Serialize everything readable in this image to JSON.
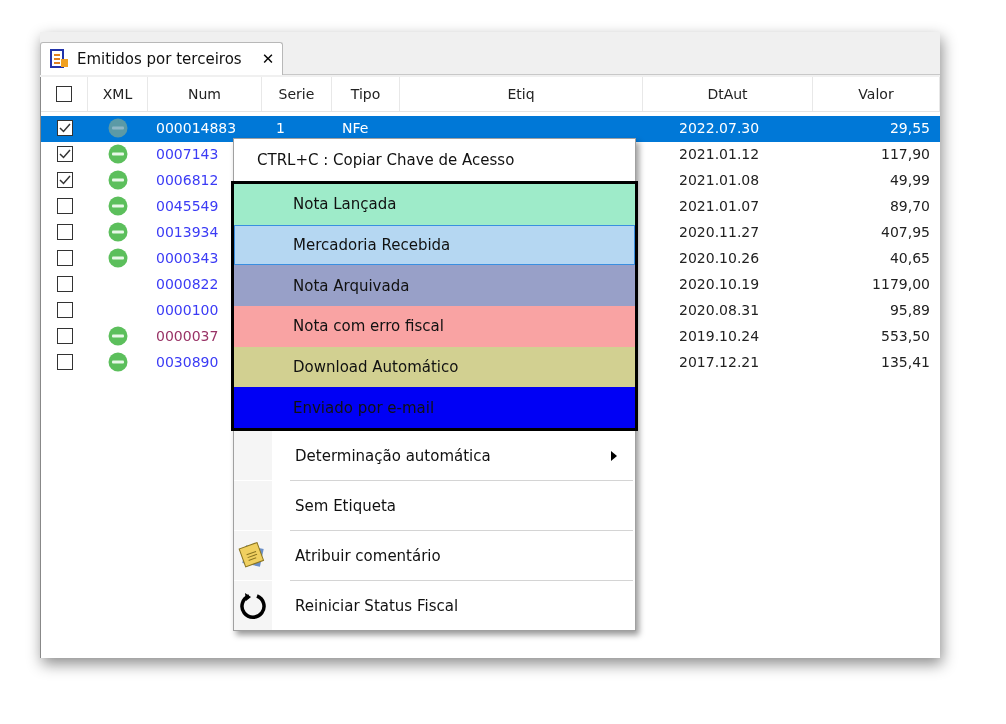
{
  "tab": {
    "title": "Emitidos por terceiros",
    "close": "✕"
  },
  "table": {
    "select_all": {
      "checked": false
    },
    "columns": [
      "XML",
      "Num",
      "Serie",
      "Tipo",
      "Etiq",
      "DtAut",
      "Valor"
    ],
    "rows": [
      {
        "selected": true,
        "checked": true,
        "xml": true,
        "num": "000014883",
        "color": "#ffffff",
        "serie": "1",
        "tipo": "NFe",
        "dtaut": "2022.07.30",
        "valor": "29,55"
      },
      {
        "selected": false,
        "checked": true,
        "xml": true,
        "num": "0007143",
        "color": "#3b3bf5",
        "dtaut": "2021.01.12",
        "valor": "117,90"
      },
      {
        "selected": false,
        "checked": true,
        "xml": true,
        "num": "0006812",
        "color": "#3b3bf5",
        "dtaut": "2021.01.08",
        "valor": "49,99"
      },
      {
        "selected": false,
        "checked": false,
        "xml": true,
        "num": "0045549",
        "color": "#3b3bf5",
        "dtaut": "2021.01.07",
        "valor": "89,70"
      },
      {
        "selected": false,
        "checked": false,
        "xml": true,
        "num": "0013934",
        "color": "#3b3bf5",
        "dtaut": "2020.11.27",
        "valor": "407,95"
      },
      {
        "selected": false,
        "checked": false,
        "xml": true,
        "num": "0000343",
        "color": "#3b3bf5",
        "dtaut": "2020.10.26",
        "valor": "40,65"
      },
      {
        "selected": false,
        "checked": false,
        "xml": false,
        "num": "0000822",
        "color": "#3b3bf5",
        "dtaut": "2020.10.19",
        "valor": "1179,00"
      },
      {
        "selected": false,
        "checked": false,
        "xml": false,
        "num": "0000100",
        "color": "#3b3bf5",
        "dtaut": "2020.08.31",
        "valor": "95,89"
      },
      {
        "selected": false,
        "checked": false,
        "xml": true,
        "num": "0000037",
        "color": "#993366",
        "dtaut": "2019.10.24",
        "valor": "553,50"
      },
      {
        "selected": false,
        "checked": false,
        "xml": true,
        "num": "0030890",
        "color": "#3b3bf5",
        "dtaut": "2017.12.21",
        "valor": "135,41"
      }
    ]
  },
  "context_menu": {
    "copy_item": "CTRL+C : Copiar Chave de Acesso",
    "tags": [
      {
        "label": "Nota Lançada",
        "color": "#9eebc9",
        "selected": false
      },
      {
        "label": "Mercadoria Recebida",
        "color": "#b5d7f2",
        "selected": true
      },
      {
        "label": "Nota Arquivada",
        "color": "#98a0c8",
        "selected": false
      },
      {
        "label": "Nota com erro fiscal",
        "color": "#f9a3a3",
        "selected": false
      },
      {
        "label": "Download Automático",
        "color": "#d2d091",
        "selected": false
      },
      {
        "label": "Enviado por e-mail",
        "color": "#0000f5",
        "selected": false
      }
    ],
    "items": [
      {
        "kind": "submenu",
        "label": "Determinação automática"
      },
      {
        "kind": "plain",
        "label": "Sem Etiqueta"
      },
      {
        "kind": "note",
        "label": "Atribuir comentário"
      },
      {
        "kind": "reset",
        "label": "Reiniciar Status Fiscal"
      }
    ]
  }
}
